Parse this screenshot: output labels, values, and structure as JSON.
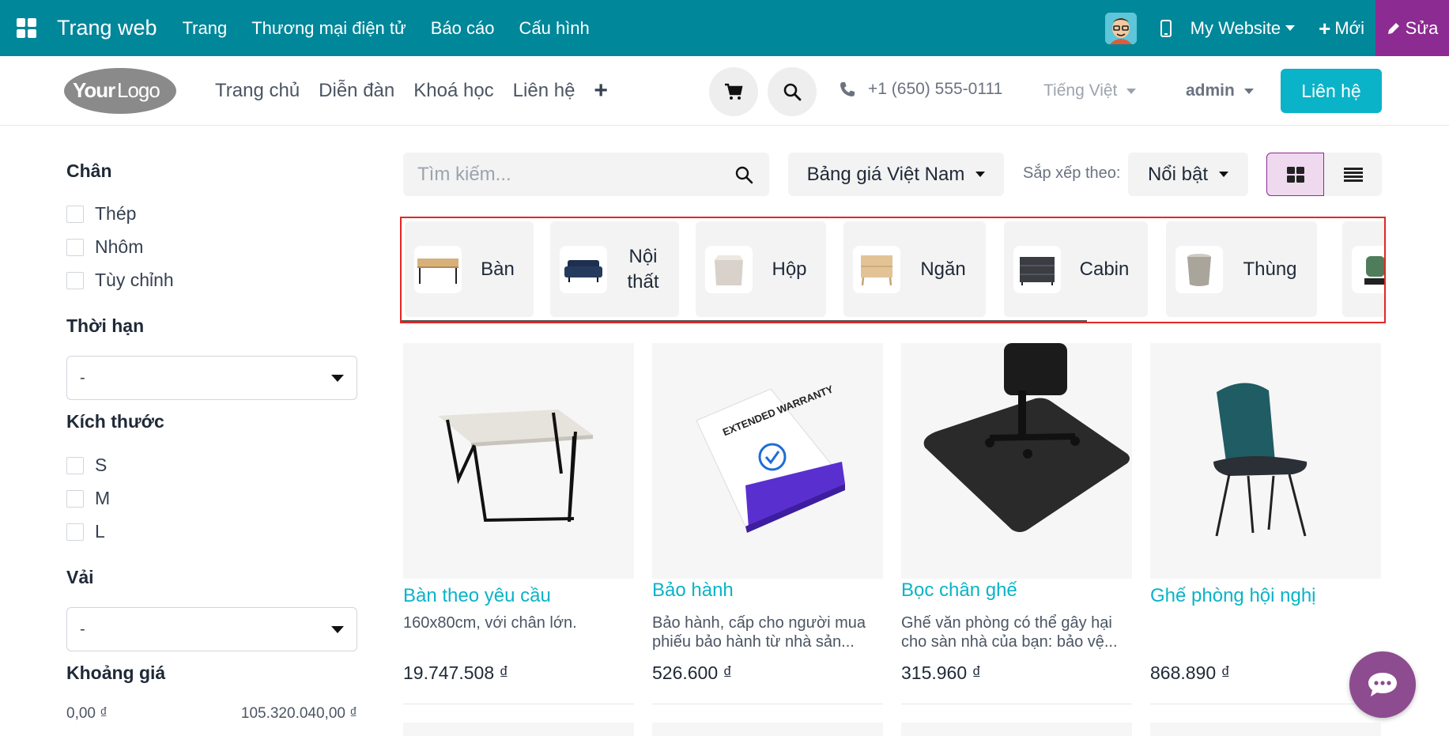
{
  "topbar": {
    "brand": "Trang web",
    "menus": [
      "Trang",
      "Thương mại điện tử",
      "Báo cáo",
      "Cấu hình"
    ],
    "website": "My Website",
    "new_label": "Mới",
    "edit_label": "Sửa",
    "colors": {
      "bar": "#00879a",
      "edit": "#8c2b92"
    }
  },
  "header": {
    "logo_text": {
      "your": "Your",
      "logo": "Logo"
    },
    "nav": [
      "Trang chủ",
      "Diễn đàn",
      "Khoá học",
      "Liên hệ"
    ],
    "phone": "+1 (650) 555-0111",
    "language": "Tiếng Việt",
    "user": "admin",
    "contact_button": "Liên hệ",
    "accent": "#0ab3c8"
  },
  "sidebar": {
    "groups": [
      {
        "title": "Chân",
        "options": [
          "Thép",
          "Nhôm",
          "Tùy chỉnh"
        ]
      },
      {
        "title": "Thời hạn",
        "select": "-"
      },
      {
        "title": "Kích thước",
        "options": [
          "S",
          "M",
          "L"
        ]
      },
      {
        "title": "Vải",
        "select": "-"
      },
      {
        "title": "Khoảng giá",
        "range": {
          "min": "0,00 ₫",
          "max": "105.320.040,00 ₫"
        }
      }
    ]
  },
  "toolbar": {
    "search_placeholder": "Tìm kiếm...",
    "pricelist": "Bảng giá Việt Nam",
    "sort_label": "Sắp xếp theo:",
    "sort_value": "Nổi bật"
  },
  "categories": [
    {
      "label": "Bàn",
      "icon": "desk-icon"
    },
    {
      "label": "Nội thất",
      "icon": "sofa-icon"
    },
    {
      "label": "Hộp",
      "icon": "box-icon"
    },
    {
      "label": "Ngăn",
      "icon": "drawer-icon"
    },
    {
      "label": "Cabin",
      "icon": "cabinet-icon"
    },
    {
      "label": "Thùng",
      "icon": "bin-icon"
    },
    {
      "label": "",
      "icon": "lamp-icon"
    }
  ],
  "products": [
    {
      "name": "Bàn theo yêu cầu",
      "desc": "160x80cm, với chân lớn.",
      "price": "19.747.508 ₫"
    },
    {
      "name": "Bảo hành",
      "desc": "Bảo hành, cấp cho người mua phiếu bảo hành từ nhà sản...",
      "price": "526.600 ₫",
      "box_text": "EXTENDED WARRANTY"
    },
    {
      "name": "Bọc chân ghế",
      "desc": "Ghế văn phòng có thể gây hại cho sàn nhà của bạn: bảo vệ...",
      "price": "315.960 ₫"
    },
    {
      "name": "Ghế phòng hội nghị",
      "desc": "",
      "price": "868.890 ₫"
    }
  ]
}
